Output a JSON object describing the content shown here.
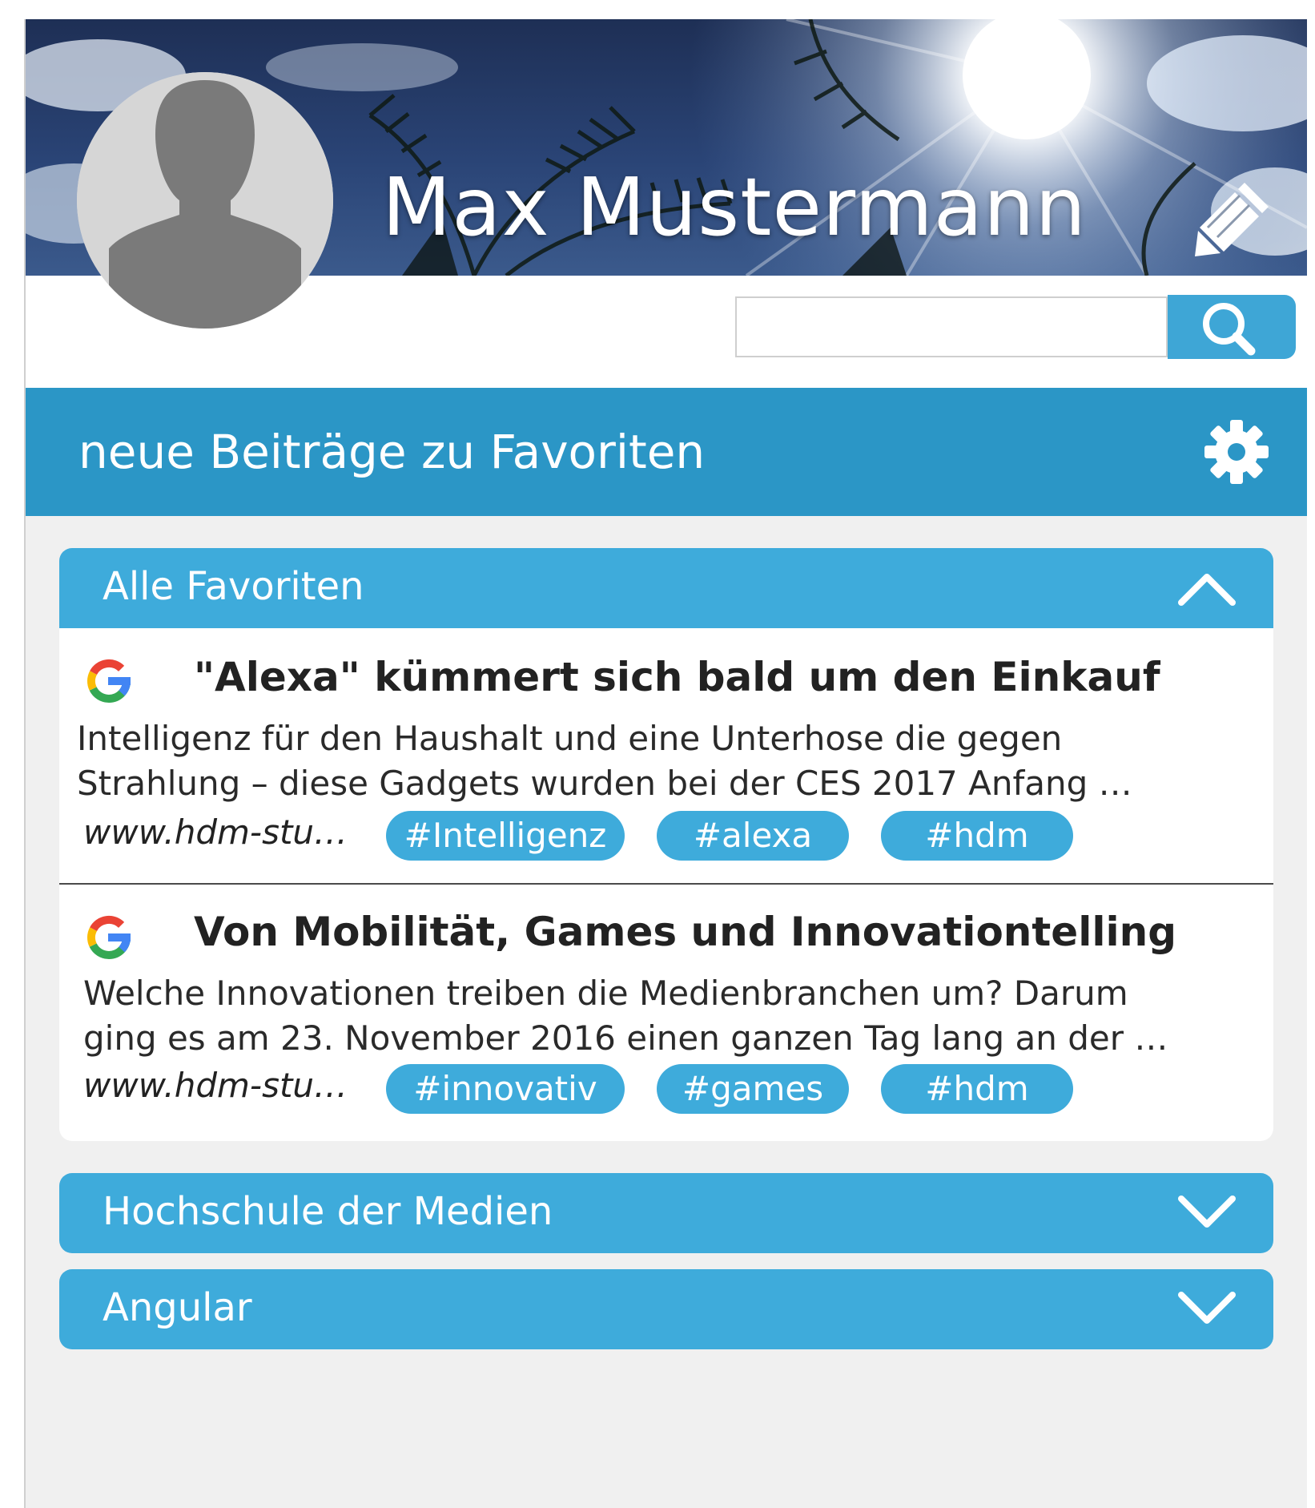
{
  "profile": {
    "name": "Max Mustermann",
    "edit_icon": "pencil-icon",
    "avatar_icon": "user-silhouette-icon"
  },
  "search": {
    "placeholder": "",
    "value": "",
    "icon": "search-icon"
  },
  "section": {
    "title": "neue Beiträge zu Favoriten",
    "settings_icon": "gear-icon"
  },
  "favorites": [
    {
      "label": "Alle Favoriten",
      "expanded": true,
      "chevron": "chevron-up-icon",
      "articles": [
        {
          "source_icon": "google-icon",
          "title": "\"Alexa\" kümmert sich bald um den Einkauf",
          "excerpt_line1": "Intelligenz für den Haushalt und eine Unterhose die gegen",
          "excerpt_line2": "Strahlung – diese Gadgets wurden bei der CES 2017 Anfang …",
          "url": "www.hdm-stu…",
          "tags": [
            "#Intelligenz",
            "#alexa",
            "#hdm"
          ]
        },
        {
          "source_icon": "google-icon",
          "title": "Von Mobilität, Games und Innovationtelling",
          "excerpt_line1": "Welche Innovationen treiben die Medienbranchen um? Darum",
          "excerpt_line2": "ging es am 23. November 2016 einen ganzen Tag lang an der …",
          "url": "www.hdm-stu…",
          "tags": [
            "#innovativ",
            "#games",
            "#hdm"
          ]
        }
      ]
    },
    {
      "label": "Hochschule der Medien",
      "expanded": false,
      "chevron": "chevron-down-icon"
    },
    {
      "label": "Angular",
      "expanded": false,
      "chevron": "chevron-down-icon"
    }
  ],
  "colors": {
    "accent": "#3eabdb",
    "section_bar": "#2b96c6",
    "background": "#f0f0f0",
    "text": "#222222"
  }
}
